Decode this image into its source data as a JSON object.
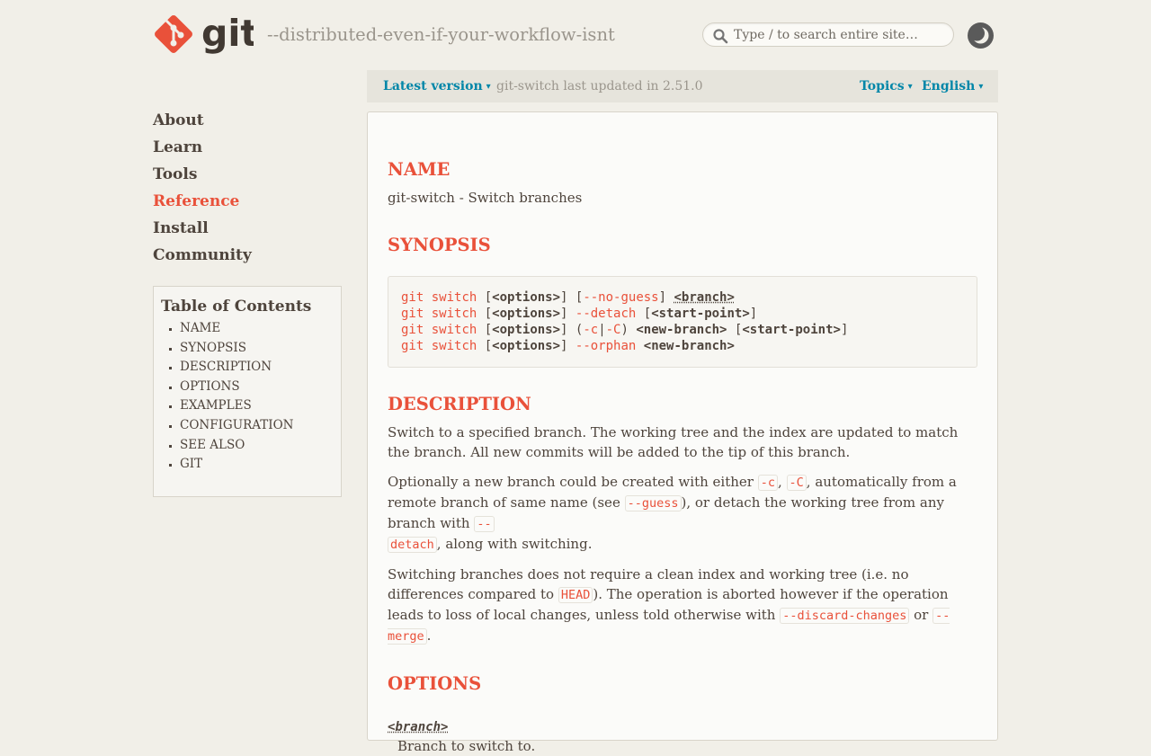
{
  "header": {
    "logo_text": "git",
    "tagline": "--distributed-even-if-your-workflow-isnt",
    "search_placeholder": "Type / to search entire site…"
  },
  "version_bar": {
    "latest_label": "Latest version",
    "updated_text": "git-switch last updated in 2.51.0",
    "topics_label": "Topics",
    "language_label": "English",
    "caret": "▾"
  },
  "nav": {
    "items": [
      "About",
      "Learn",
      "Tools",
      "Reference",
      "Install",
      "Community"
    ],
    "active": "Reference"
  },
  "toc": {
    "title": "Table of Contents",
    "items": [
      "NAME",
      "SYNOPSIS",
      "DESCRIPTION",
      "OPTIONS",
      "EXAMPLES",
      "CONFIGURATION",
      "SEE ALSO",
      "GIT"
    ]
  },
  "content": {
    "name_heading": "NAME",
    "name_text": "git-switch - Switch branches",
    "synopsis_heading": "SYNOPSIS",
    "synopsis": {
      "git": "git",
      "switch": "switch",
      "options": "<options>",
      "no_guess": "--no-guess",
      "branch": "<branch>",
      "detach": "--detach",
      "start_point": "<start-point>",
      "c": "-c",
      "C": "-C",
      "new_branch": "<new-branch>",
      "orphan": "--orphan"
    },
    "description_heading": "DESCRIPTION",
    "desc_p1": "Switch to a specified branch. The working tree and the index are updated to match the branch. All new commits will be added to the tip of this branch.",
    "desc_p2": {
      "t1": "Optionally a new branch could be created with either ",
      "c1": "-c",
      "t2": ", ",
      "c2": "-C",
      "t3": ", automatically from a remote branch of same name (see ",
      "c3": "--guess",
      "t4": "), or detach the working tree from any branch with ",
      "c4a": "--",
      "c4b": "detach",
      "t5": ", along with switching."
    },
    "desc_p3": {
      "t1": "Switching branches does not require a clean index and working tree (i.e. no differences compared to ",
      "c1": "HEAD",
      "t2": "). The operation is aborted however if the operation leads to loss of local changes, unless told otherwise with ",
      "c2": "--discard-changes",
      "t3": " or ",
      "c3": "--merge",
      "t4": "."
    },
    "options_heading": "OPTIONS",
    "option_branch": "<branch>",
    "option_branch_desc": "Branch to switch to."
  }
}
